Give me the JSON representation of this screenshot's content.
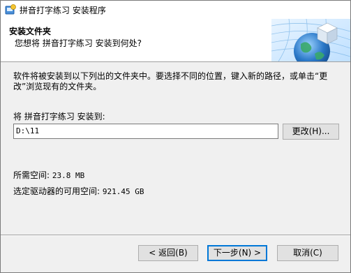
{
  "window": {
    "title": "拼音打字练习 安装程序"
  },
  "header": {
    "title": "安装文件夹",
    "subtitle": "您想将 拼音打字练习 安装到何处?"
  },
  "main": {
    "description": "软件将被安装到以下列出的文件夹中。要选择不同的位置，键入新的路径，或单击“更改”浏览现有的文件夹。",
    "install_label": "将 拼音打字练习 安装到:",
    "path_value": "D:\\11",
    "change_button": "更改(H)...",
    "space_required_label": "所需空间:",
    "space_required_value": "23.8 MB",
    "space_available_label": "选定驱动器的可用空间:",
    "space_available_value": "921.45 GB"
  },
  "footer": {
    "back_button": "< 返回(B)",
    "next_button": "下一步(N) >",
    "cancel_button": "取消(C)"
  },
  "icons": {
    "app": "installer-app-icon",
    "header_graphic": "globe-cube-icon"
  },
  "colors": {
    "header_bg": "#ffffff",
    "dialog_bg": "#f0f0f0",
    "focus_border": "#0078d7",
    "globe_blue": "#2a78c8",
    "globe_green": "#3aa86a"
  }
}
